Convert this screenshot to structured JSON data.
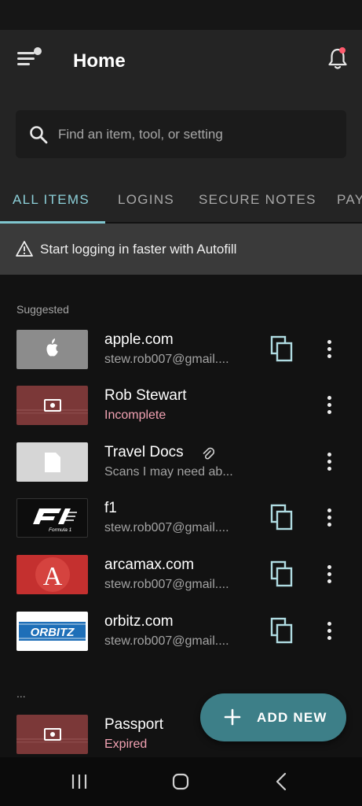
{
  "header": {
    "title": "Home"
  },
  "search": {
    "placeholder": "Find an item, tool, or setting"
  },
  "tabs": [
    {
      "label": "ALL ITEMS",
      "active": true
    },
    {
      "label": "LOGINS",
      "active": false
    },
    {
      "label": "SECURE NOTES",
      "active": false
    },
    {
      "label": "PAY",
      "active": false
    }
  ],
  "banner": {
    "text": "Start logging in faster with Autofill"
  },
  "sections": {
    "suggested": "Suggested",
    "more": "..."
  },
  "items": [
    {
      "title": "apple.com",
      "subtitle": "stew.rob007@gmail....",
      "thumb": "apple-logo",
      "copy": true
    },
    {
      "title": "Rob Stewart",
      "subtitle": "Incomplete",
      "thumb": "identity-card",
      "copy": false,
      "status": "warning"
    },
    {
      "title": "Travel Docs",
      "subtitle": "Scans I may need ab...",
      "thumb": "document",
      "copy": false,
      "attachment": true
    },
    {
      "title": "f1",
      "subtitle": "stew.rob007@gmail....",
      "thumb": "f1-logo",
      "copy": true
    },
    {
      "title": "arcamax.com",
      "subtitle": "stew.rob007@gmail....",
      "thumb": "arcamax-logo",
      "copy": true
    },
    {
      "title": "orbitz.com",
      "subtitle": "stew.rob007@gmail....",
      "thumb": "orbitz-logo",
      "copy": true
    },
    {
      "title": "Passport",
      "subtitle": "Expired",
      "thumb": "identity-card",
      "copy": false,
      "status": "warning"
    }
  ],
  "fab": {
    "label": "ADD NEW"
  },
  "logos": {
    "f1_caption": "Formula 1",
    "arcamax_letter": "A",
    "orbitz_text": "ORBITZ"
  },
  "colors": {
    "accent": "#8ccfd8",
    "fab": "#3d7f88",
    "warning": "#f2a2b3",
    "notification": "#ff5b6e"
  }
}
